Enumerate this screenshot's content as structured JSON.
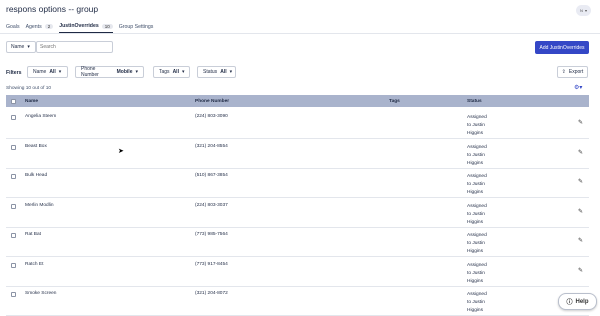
{
  "page": {
    "title": "respons options -- group",
    "avatar_initials": "N"
  },
  "tabs": [
    {
      "label": "Goals",
      "count": null
    },
    {
      "label": "Agents",
      "count": "2"
    },
    {
      "label": "JustinOverrides",
      "count": "10"
    },
    {
      "label": "Group Settings",
      "count": null
    }
  ],
  "toolbar": {
    "name_select": "Name",
    "search_placeholder": "Search",
    "add_button": "Add JustinOverrides"
  },
  "filters": {
    "label": "Filters",
    "items": [
      {
        "name": "Name",
        "value": "All"
      },
      {
        "name": "Phone Number",
        "value": "Mobile"
      },
      {
        "name": "Tags",
        "value": "All"
      },
      {
        "name": "Status",
        "value": "All"
      }
    ],
    "export_label": "Export"
  },
  "table": {
    "showing": "Showing 10 out of 10",
    "columns": [
      "Name",
      "Phone Number",
      "Tags",
      "Status"
    ],
    "rows": [
      {
        "name": "Angelia Steem",
        "phone": "(224) 803-3090",
        "tags": "",
        "status": [
          "Assigned",
          "to Justin",
          "Higgins"
        ]
      },
      {
        "name": "Beast Box",
        "phone": "(321) 204-8554",
        "tags": "",
        "status": [
          "Assigned",
          "to Justin",
          "Higgins"
        ]
      },
      {
        "name": "Bulk Head",
        "phone": "(510) 867-3854",
        "tags": "",
        "status": [
          "Assigned",
          "to Justin",
          "Higgins"
        ]
      },
      {
        "name": "Merlin Modlin",
        "phone": "(224) 803-3037",
        "tags": "",
        "status": [
          "Assigned",
          "to Justin",
          "Higgins"
        ]
      },
      {
        "name": "Rat Bat",
        "phone": "(773) 985-7564",
        "tags": "",
        "status": [
          "Assigned",
          "to Justin",
          "Higgins"
        ]
      },
      {
        "name": "Ratch Et",
        "phone": "(773) 917-8454",
        "tags": "",
        "status": [
          "Assigned",
          "to Justin",
          "Higgins"
        ]
      },
      {
        "name": "Smoke Screen",
        "phone": "(321) 204-8072",
        "tags": "",
        "status": [
          "Assigned",
          "to Justin",
          "Higgins"
        ]
      }
    ]
  },
  "help": {
    "label": "Help"
  },
  "colors": {
    "primary": "#3447c6",
    "table_header": "#a9b3cc",
    "text": "#1f2a44"
  }
}
